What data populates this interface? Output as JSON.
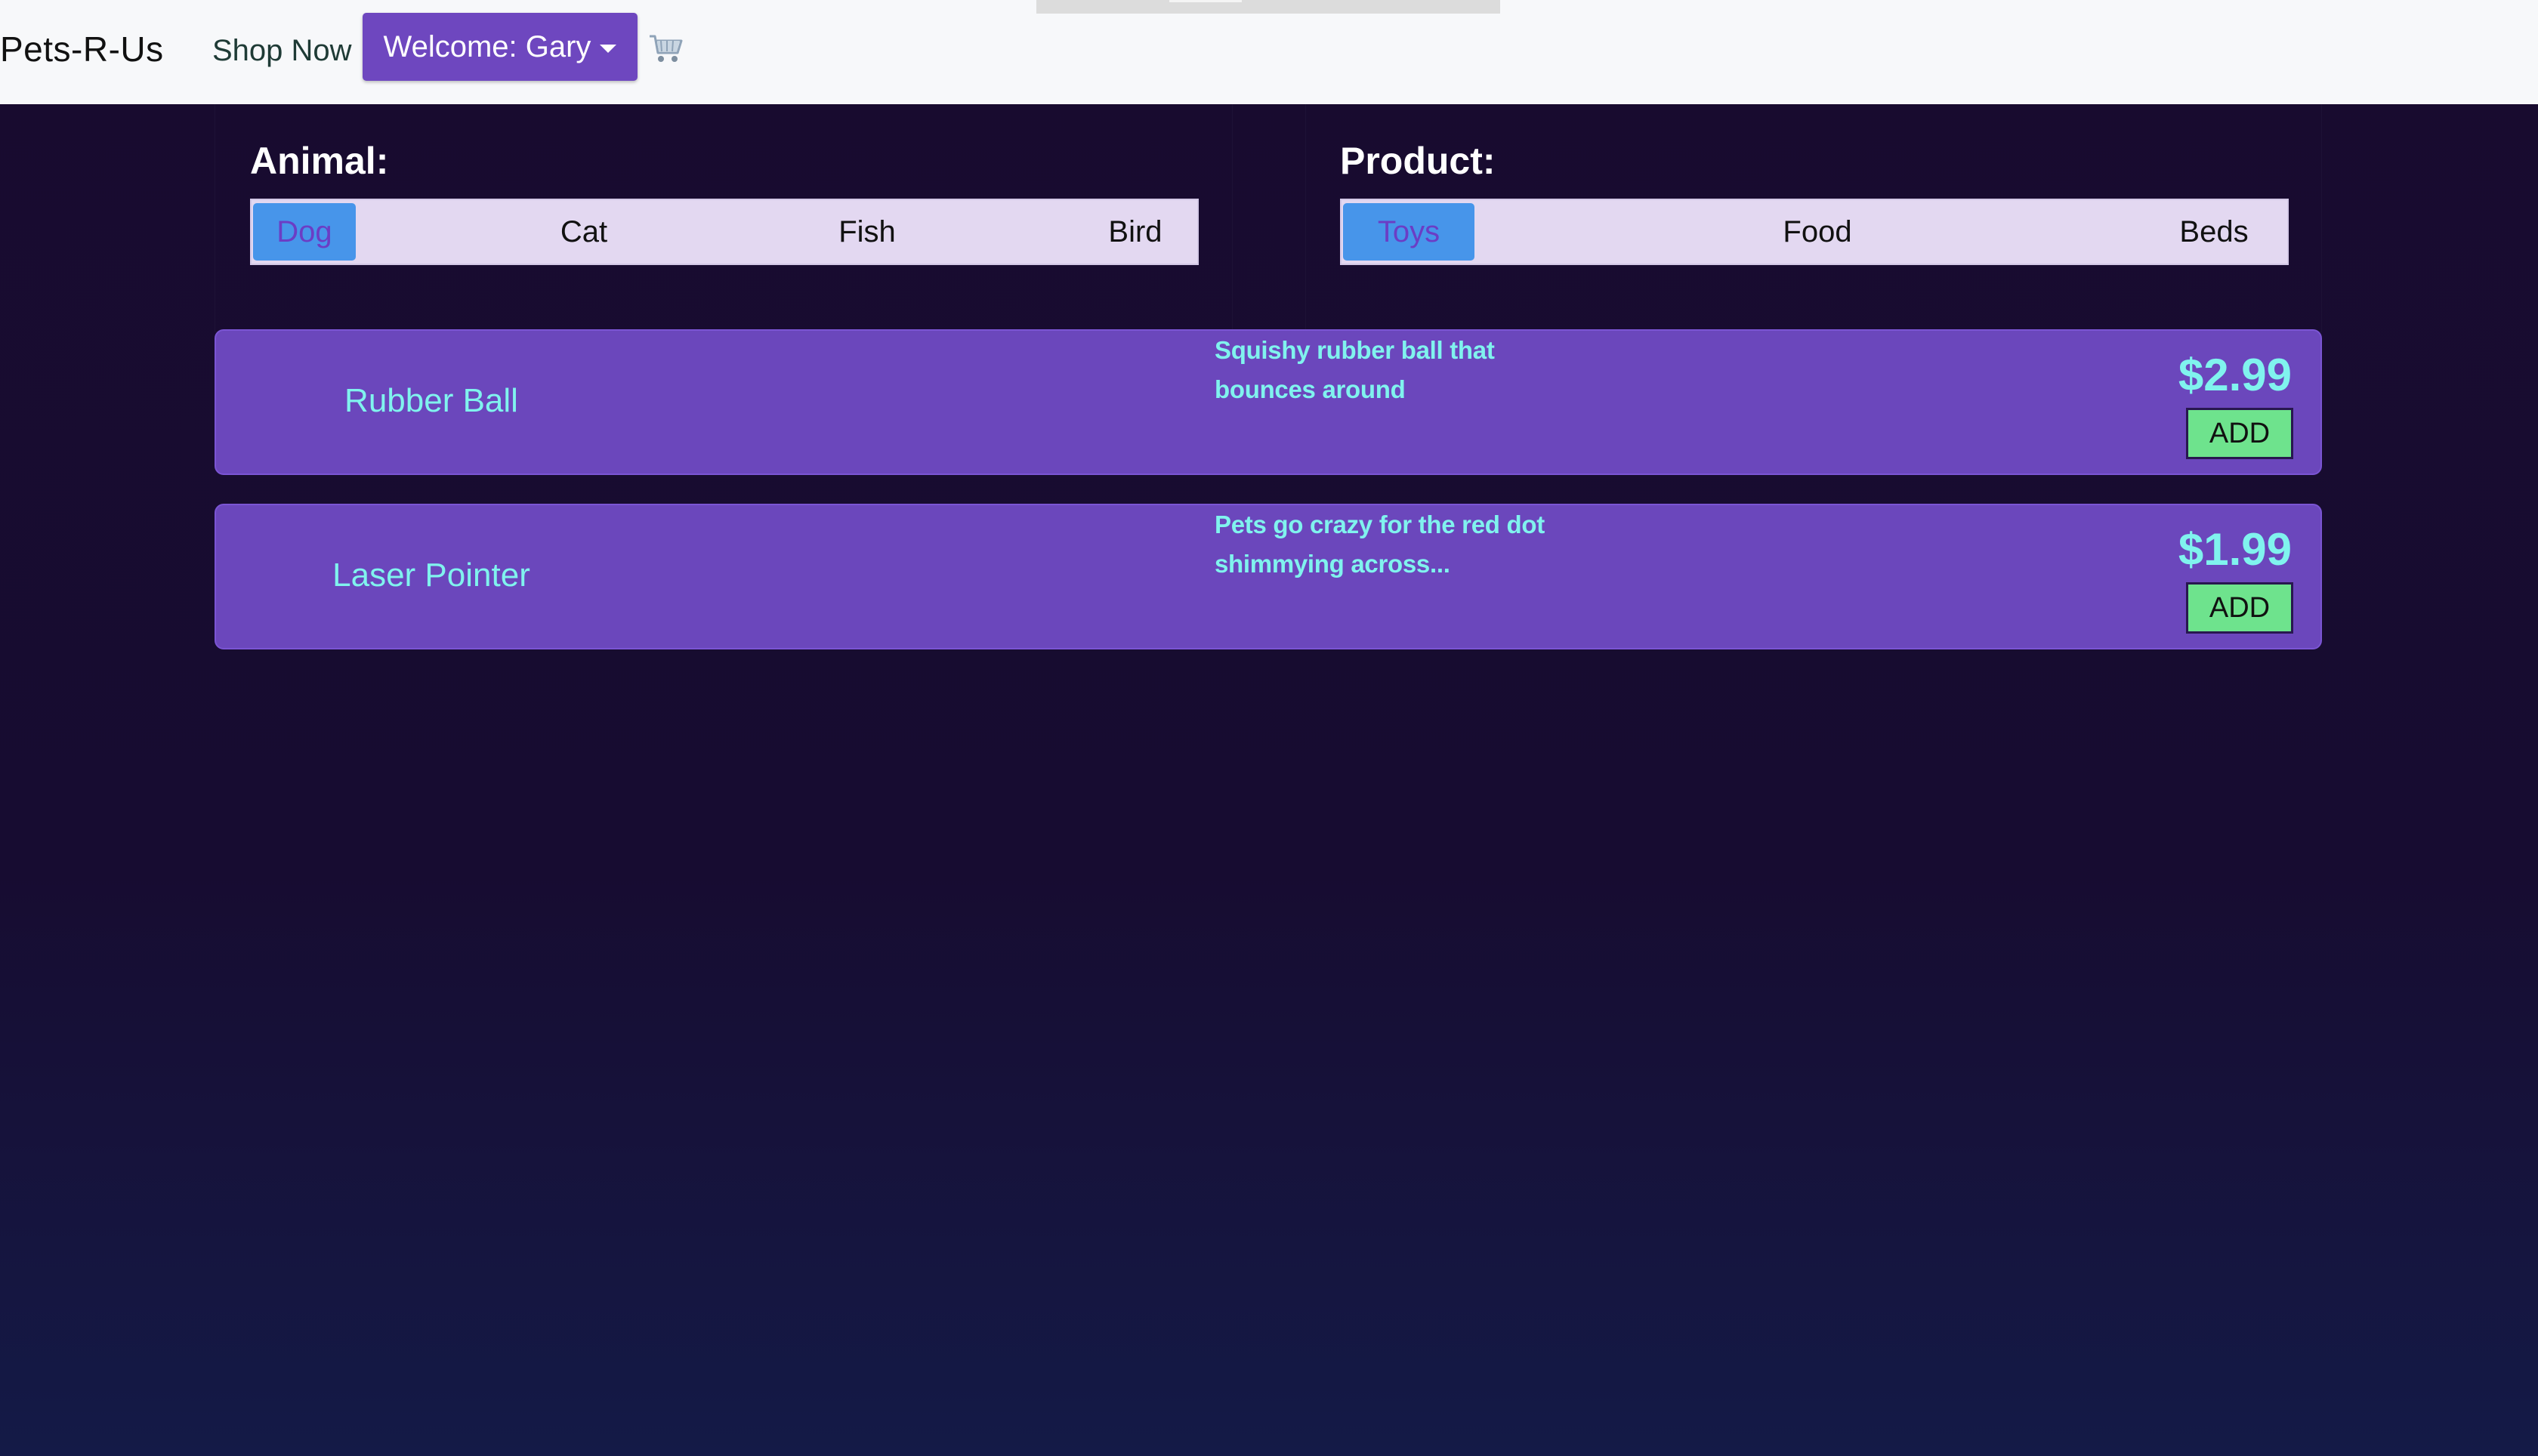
{
  "navbar": {
    "brand": "Pets-R-Us",
    "shop_link": "Shop Now",
    "welcome_label": "Welcome: Gary",
    "cart_icon": "cart-icon"
  },
  "filters": {
    "animal": {
      "label": "Animal:",
      "options": [
        "Dog",
        "Cat",
        "Fish",
        "Bird"
      ],
      "selected": "Dog"
    },
    "product": {
      "label": "Product:",
      "options": [
        "Toys",
        "Food",
        "Beds"
      ],
      "selected": "Toys"
    }
  },
  "products": [
    {
      "name": "Rubber Ball",
      "description": "Squishy rubber ball that bounces around",
      "price": "$2.99",
      "button": "ADD"
    },
    {
      "name": "Laser Pointer",
      "description": "Pets go crazy for the red dot shimmying across...",
      "price": "$1.99",
      "button": "ADD"
    }
  ],
  "colors": {
    "accent_purple": "#6e47bf",
    "card_purple": "#6b47bc",
    "text_cyan": "#80f3ee",
    "add_green": "#6ee38d",
    "active_blue": "#4795ea"
  }
}
